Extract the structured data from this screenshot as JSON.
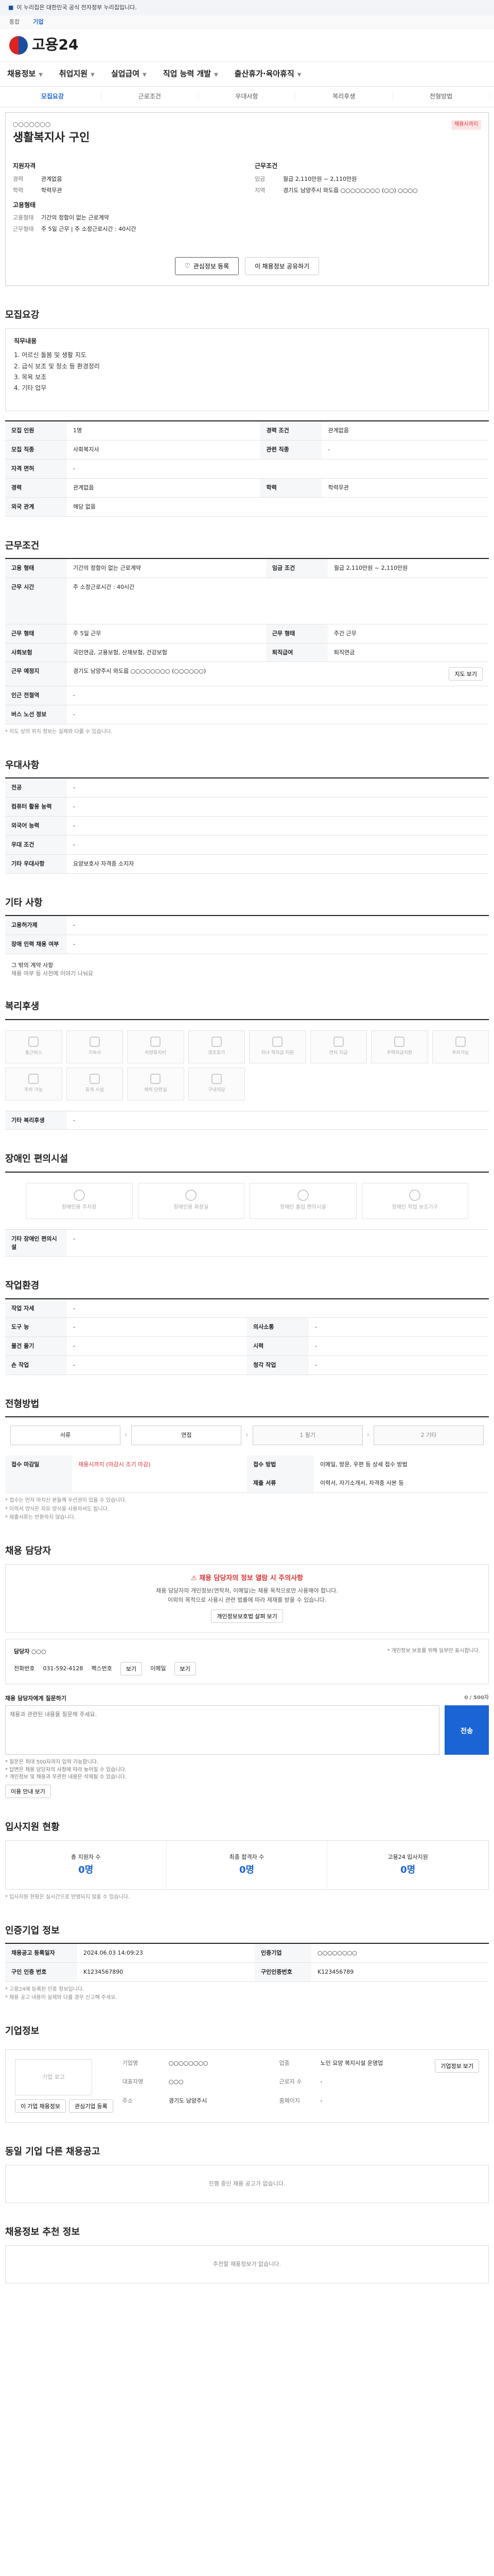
{
  "gov": {
    "banner": "이 누리집은 대한민국 공식 전자정부 누리집입니다.",
    "tabs": [
      "통합",
      "기업"
    ]
  },
  "brand": {
    "name": "고용24"
  },
  "gnb": [
    "채용정보",
    "취업지원",
    "실업급여",
    "직업 능력 개발",
    "출산휴가·육아휴직"
  ],
  "page_tabs": [
    "모집요강",
    "근로조건",
    "우대사항",
    "복리후생",
    "전형방법"
  ],
  "company": {
    "name": "○○○○○○○",
    "title": "생활복지사 구인",
    "badge": "채용시까지",
    "qual_head": "지원자격",
    "conditions_head": "근무조건",
    "qual": [
      {
        "k": "경력",
        "v": "관계없음"
      },
      {
        "k": "학력",
        "v": "학력무관"
      }
    ],
    "conditions": [
      {
        "k": "임금",
        "v": "월급 2,110만원 ~ 2,110만원"
      },
      {
        "k": "지역",
        "v": "경기도 남양주시 와도읍 ○○○○○○○○ (○○) ○○○○"
      }
    ],
    "employ_head": "고용형태",
    "employ": [
      {
        "k": "고용형태",
        "v": "기간의 정함이 없는 근로계약"
      },
      {
        "k": "근무형태",
        "v": "주 5일 근무 | 주 소정근로시간 : 40시간"
      }
    ],
    "btn_save": "관심정보 등록",
    "btn_share": "이 채용정보 공유하기"
  },
  "recruit": {
    "title": "모집요강",
    "duty_head": "직무내용",
    "duty_lines": [
      "1. 어르신 돌봄 및 생활 지도",
      "2. 급식 보조 및 청소 등 환경정리",
      "3. 목욕 보조",
      "4. 기타 업무"
    ],
    "rows": [
      {
        "k1": "모집 인원",
        "v1": "1명",
        "k2": "경력 조건",
        "v2": "관계없음"
      },
      {
        "k1": "모집 직종",
        "v1": "사회복지사",
        "k2": "관련 직종",
        "v2": "-"
      },
      {
        "k1": "자격 면허",
        "v1": "-",
        "k2": "",
        "v2": ""
      },
      {
        "k1": "경력",
        "v1": "관계없음",
        "k2": "학력",
        "v2": "학력무관"
      },
      {
        "k1": "외국 관계",
        "v1": "해당 없음",
        "k2": "",
        "v2": ""
      }
    ]
  },
  "work": {
    "title": "근무조건",
    "rows": [
      {
        "k1": "고용 형태",
        "v1": "기간의 정함이 없는 근로계약",
        "k2": "임금 조건",
        "v2": "월급 2,110만원 ~ 2,110만원"
      },
      {
        "k1": "근무 시간",
        "v1": "주 소정근로시간 : 40시간",
        "k2": "",
        "v2": ""
      },
      {
        "k1": "근무 형태",
        "v1": "주 5일 근무",
        "k2": "근무 형태",
        "v2": "주간 근무"
      },
      {
        "k1": "사회보험",
        "v1": "국민연금, 고용보험, 산재보험, 건강보험",
        "k2": "퇴직급여",
        "v2": "퇴직연금"
      },
      {
        "k1": "근무 예정지",
        "v1": "경기도 남양주시 와도읍 ○○○○○○○○ (○○○○○○)",
        "k2": "",
        "v2": ""
      },
      {
        "k1": "인근 전철역",
        "v1": "-",
        "k2": "",
        "v2": ""
      },
      {
        "k1": "버스 노선 정보",
        "v1": "-",
        "k2": "",
        "v2": ""
      }
    ],
    "map_btn": "지도 보기",
    "note": "* 지도 상의 위치 정보는 실제와 다를 수 있습니다."
  },
  "prefer": {
    "title": "우대사항",
    "rows": [
      {
        "k": "전공",
        "v": "-"
      },
      {
        "k": "컴퓨터 활용 능력",
        "v": "-"
      },
      {
        "k": "외국어 능력",
        "v": "-"
      },
      {
        "k": "우대 조건",
        "v": "-"
      },
      {
        "k": "기타 우대사항",
        "v": "요양보호사 자격증 소지자"
      }
    ]
  },
  "disabled": {
    "title": "기타 사항",
    "rows": [
      {
        "k": "고용허가제",
        "v": "-"
      },
      {
        "k": "장애 인력 채용 여부",
        "v": "-"
      }
    ],
    "note1": "그 밖의 계약 사항",
    "note2": "채용 여부 등 사전에 이야기 나눠요"
  },
  "welfare": {
    "title": "복리후생",
    "items": [
      "통근버스",
      "기숙사",
      "차량유지비",
      "경조휴가",
      "자녀 학자금 지원",
      "연차 지급",
      "주택자금지원",
      "주차가능",
      "주차 가능",
      "휴게 시설",
      "체력 단련실",
      "구내식당"
    ],
    "row_label": "기타 복리후생",
    "row_value": "-"
  },
  "facility": {
    "title": "장애인 편의시설",
    "items": [
      "장애인용 주차장",
      "장애인용 화장실",
      "장애인 출입 편의시설",
      "장애인 작업 보조기구"
    ],
    "row_label": "기타 장애인 편의시설",
    "row_value": "-"
  },
  "env": {
    "title": "작업환경",
    "rows": [
      {
        "k1": "작업 자세",
        "v1": "-",
        "k2": "",
        "v2": ""
      },
      {
        "k1": "도구 능",
        "v1": "-",
        "k2": "의사소통",
        "v2": "-"
      },
      {
        "k1": "물건 들기",
        "v1": "-",
        "k2": "시력",
        "v2": "-"
      },
      {
        "k1": "손 작업",
        "v1": "-",
        "k2": "청각 작업",
        "v2": "-"
      }
    ]
  },
  "process": {
    "title": "전형방법",
    "steps": [
      "서류",
      "면접",
      "1 필기",
      "2 기타"
    ],
    "rows": [
      {
        "k1": "접수 마감일",
        "v1": "채용시까지 (마감시 조기 마감)",
        "k2": "접수 방법",
        "v2": "이메일, 방문, 우편 등 상세 접수 방법"
      },
      {
        "k1": "",
        "v1": "",
        "k2": "제출 서류",
        "v2": "이력서, 자기소개서, 자격증 사본 등"
      }
    ],
    "notes": [
      "* 접수는 먼저 마치신 분들께 우선권이 있을 수 있습니다.",
      "* 이력서 양식은 자유 양식을 사용하셔도 됩니다.",
      "* 제출서류는 반환하지 않습니다."
    ]
  },
  "contact": {
    "title": "채용 담당자",
    "alert_title": "채용 담당자의 정보 열람 시 주의사항",
    "alert_lines": [
      "채용 담당자의 개인정보(연락처, 이메일)는 채용 목적으로만 사용해야 합니다.",
      "이외의 목적으로 사용시 관련 법률에 따라 제재를 받을 수 있습니다."
    ],
    "alert_btn": "개인정보보호법 살펴 보기",
    "name_label": "담당자",
    "name_value": "○○○",
    "phone_label": "전화번호",
    "phone_value": "031-592-4128",
    "fax_label": "팩스번호",
    "email_label": "이메일",
    "view_btn": "보기",
    "privacy_note": "* 개인정보 보호를 위해 일부만 표시합니다."
  },
  "inquiry": {
    "title": "채용 담당자에게 질문하기",
    "counter": "0 / 500자",
    "placeholder": "채용과 관련된 내용을 질문해 주세요.",
    "submit": "전송",
    "bullets": [
      "* 질문은 최대 500자까지 입력 가능합니다.",
      "* 답변은 채용 담당자의 사정에 따라 늦어질 수 있습니다.",
      "* 개인정보 및 채용과 무관한 내용은 삭제될 수 있습니다."
    ],
    "notice_btn": "이용 안내 보기"
  },
  "stats": {
    "title": "입사지원 현황",
    "items": [
      {
        "label": "총 지원자 수",
        "value": "0명"
      },
      {
        "label": "최종 합격자 수",
        "value": "0명"
      },
      {
        "label": "고용24 입사지원",
        "value": "0명"
      }
    ],
    "note": "* 입사지원 현황은 실시간으로 반영되지 않을 수 있습니다."
  },
  "meta": {
    "title": "인증기업 정보",
    "rows": [
      {
        "k1": "채용공고 등록일자",
        "v1": "2024.06.03 14:09:23",
        "k2": "인증기업",
        "v2": "○○○○○○○○"
      },
      {
        "k1": "구인 인증 번호",
        "v1": "K1234567890",
        "k2": "구인인증번호",
        "v2": "K123456789"
      }
    ],
    "note1": "* 고용24에 등록된 인증 정보입니다.",
    "note2": "* 채용 공고 내용이 실제와 다를 경우 신고해 주세요."
  },
  "company_info": {
    "title": "기업정보",
    "logo_alt": "기업 로고",
    "fields": [
      {
        "k": "기업명",
        "v": "○○○○○○○○"
      },
      {
        "k": "업종",
        "v": "노인 요양 복지시설 운영업"
      },
      {
        "k": "대표자명",
        "v": "○○○"
      },
      {
        "k": "근로자 수",
        "v": "-"
      },
      {
        "k": "주소",
        "v": "경기도 남양주시"
      },
      {
        "k": "홈페이지",
        "v": "-"
      }
    ],
    "btn_left": "이 기업 채용정보",
    "btn_right": "관심기업 등록",
    "detail_btn": "기업정보 보기"
  },
  "same_company": {
    "title": "동일 기업 다른 채용공고",
    "empty": "진행 중인 채용 공고가 없습니다."
  },
  "recommend": {
    "title": "채용정보 추천 정보",
    "empty": "추천할 채용정보가 없습니다."
  }
}
